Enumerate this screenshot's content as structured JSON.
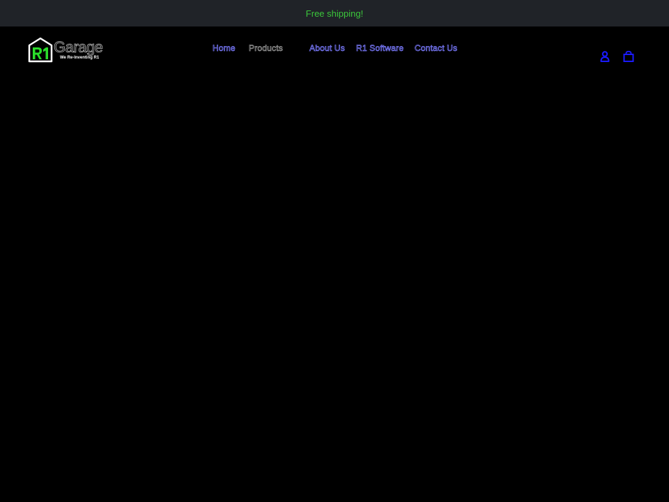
{
  "announcement": {
    "text": "Free shipping!"
  },
  "logo": {
    "mark": "R1",
    "word": "Garage",
    "tagline": "We Re-Inventing R1"
  },
  "nav": {
    "items": [
      {
        "label": "Home",
        "current": false
      },
      {
        "label": "Products",
        "current": true
      },
      {
        "label": "About Us",
        "current": false
      },
      {
        "label": "R1 Software",
        "current": false
      },
      {
        "label": "Contact Us",
        "current": false
      }
    ]
  },
  "icons": {
    "account": "account-icon",
    "cart": "cart-icon"
  },
  "colors": {
    "announcement_bg": "#202328",
    "announcement_text": "#3bc63b",
    "page_bg": "#000000",
    "nav_link": "#7b7bff",
    "nav_current": "#9a9a9a",
    "icon_blue": "#1a1aff",
    "logo_green": "#2bdc2b"
  }
}
